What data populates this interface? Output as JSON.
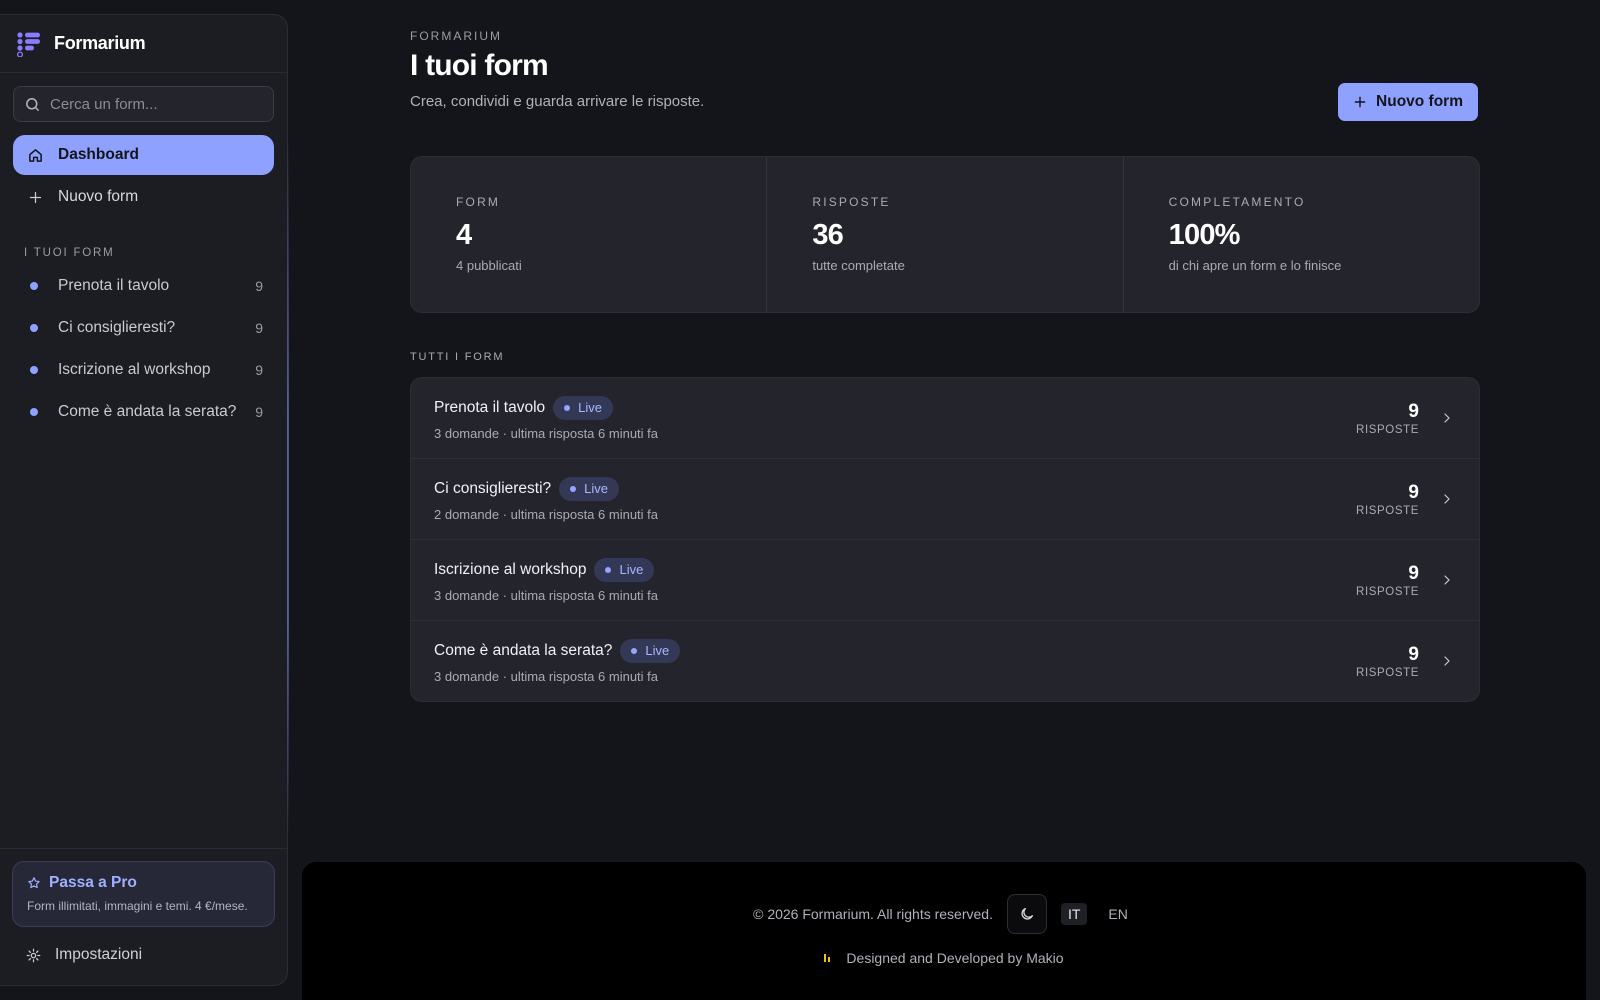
{
  "brand": {
    "name": "Formarium",
    "logo_icon": "formarium-logo",
    "accent": "#8fa1ff"
  },
  "sidebar": {
    "search_placeholder": "Cerca un form...",
    "nav": [
      {
        "label": "Dashboard",
        "icon": "home-icon",
        "active": true
      },
      {
        "label": "Nuovo form",
        "icon": "plus-icon",
        "active": false
      }
    ],
    "section_label": "I TUOI FORM",
    "forms": [
      {
        "name": "Prenota il tavolo",
        "count": "9"
      },
      {
        "name": "Ci consiglieresti?",
        "count": "9"
      },
      {
        "name": "Iscrizione al workshop",
        "count": "9"
      },
      {
        "name": "Come è andata la serata?",
        "count": "9"
      }
    ],
    "pro": {
      "title": "Passa a Pro",
      "description": "Form illimitati, immagini e temi. 4 €/mese.",
      "icon": "star-icon"
    },
    "settings_label": "Impostazioni"
  },
  "header": {
    "eyebrow": "FORMARIUM",
    "title": "I tuoi form",
    "subtitle": "Crea, condividi e guarda arrivare le risposte.",
    "new_button_label": "Nuovo form"
  },
  "stats": [
    {
      "label": "FORM",
      "value": "4",
      "sub": "4 pubblicati"
    },
    {
      "label": "RISPOSTE",
      "value": "36",
      "sub": "tutte completate"
    },
    {
      "label": "COMPLETAMENTO",
      "value": "100%",
      "sub": "di chi apre un form e lo finisce"
    }
  ],
  "list": {
    "label": "TUTTI I FORM",
    "rows": [
      {
        "title": "Prenota il tavolo",
        "status": "Live",
        "meta": "3 domande · ultima risposta 6 minuti fa",
        "count": "9",
        "count_label": "RISPOSTE"
      },
      {
        "title": "Ci consiglieresti?",
        "status": "Live",
        "meta": "2 domande · ultima risposta 6 minuti fa",
        "count": "9",
        "count_label": "RISPOSTE"
      },
      {
        "title": "Iscrizione al workshop",
        "status": "Live",
        "meta": "3 domande · ultima risposta 6 minuti fa",
        "count": "9",
        "count_label": "RISPOSTE"
      },
      {
        "title": "Come è andata la serata?",
        "status": "Live",
        "meta": "3 domande · ultima risposta 6 minuti fa",
        "count": "9",
        "count_label": "RISPOSTE"
      }
    ]
  },
  "footer": {
    "copyright": "© 2026 Formarium. All rights reserved.",
    "languages": [
      {
        "code": "IT",
        "active": true
      },
      {
        "code": "EN",
        "active": false
      }
    ],
    "credit": "Designed and Developed by Makio"
  }
}
